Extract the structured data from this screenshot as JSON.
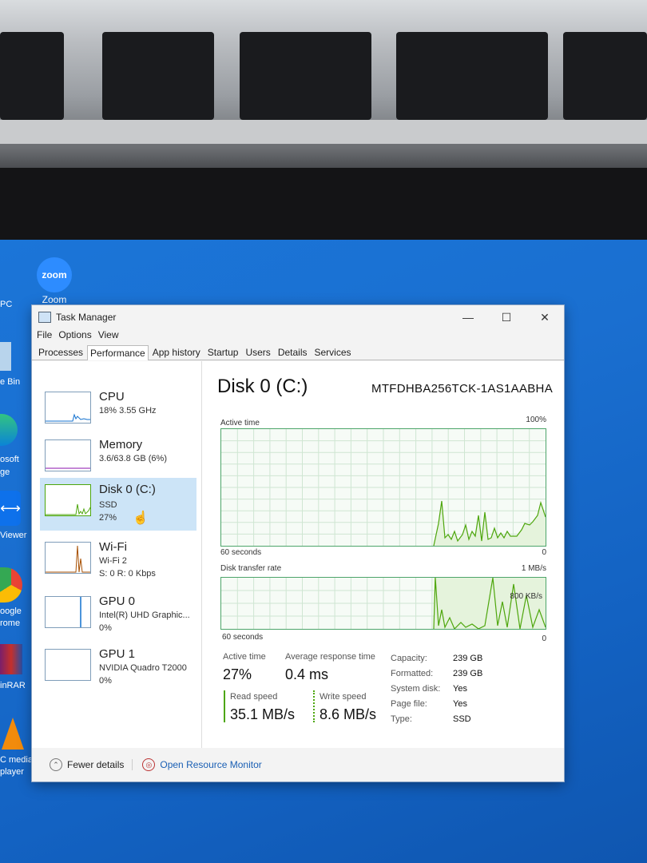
{
  "desktop": {
    "icons": [
      {
        "label": "Zoom",
        "icon": "zoom-icon",
        "badge": "zoom"
      },
      {
        "label": "PC"
      },
      {
        "label": "e Bin"
      },
      {
        "label": "osoft"
      },
      {
        "label": "ge"
      },
      {
        "label": "Viewer"
      },
      {
        "label": "oogle"
      },
      {
        "label": "rome"
      },
      {
        "label": "inRAR"
      },
      {
        "label": "C media"
      },
      {
        "label": "player"
      }
    ]
  },
  "window": {
    "title": "Task Manager",
    "menu": [
      "File",
      "Options",
      "View"
    ],
    "tabs": [
      "Processes",
      "Performance",
      "App history",
      "Startup",
      "Users",
      "Details",
      "Services"
    ],
    "active_tab": "Performance"
  },
  "sidebar": [
    {
      "name": "CPU",
      "line1": "18% 3.55 GHz",
      "line2": "",
      "color": "#1170cf"
    },
    {
      "name": "Memory",
      "line1": "3.6/63.8 GB (6%)",
      "line2": "",
      "color": "#8b12ae"
    },
    {
      "name": "Disk 0 (C:)",
      "line1": "SSD",
      "line2": "27%",
      "color": "#4da60c",
      "selected": true
    },
    {
      "name": "Wi-Fi",
      "line1": "Wi-Fi 2",
      "line2": "S: 0 R: 0 Kbps",
      "color": "#a74f01"
    },
    {
      "name": "GPU 0",
      "line1": "Intel(R) UHD Graphic...",
      "line2": "0%",
      "color": "#1170cf"
    },
    {
      "name": "GPU 1",
      "line1": "NVIDIA Quadro T2000",
      "line2": "0%",
      "color": "#1170cf"
    }
  ],
  "detail": {
    "title": "Disk 0 (C:)",
    "model": "MTFDHBA256TCK-1AS1AABHA",
    "graph1": {
      "label": "Active time",
      "max": "100%",
      "time": "60 seconds",
      "min": "0"
    },
    "graph2": {
      "label": "Disk transfer rate",
      "max": "1 MB/s",
      "inner": "800 KB/s",
      "time": "60 seconds",
      "min": "0"
    },
    "stats": {
      "active_time_label": "Active time",
      "active_time": "27%",
      "resp_label": "Average response time",
      "resp": "0.4 ms",
      "read_label": "Read speed",
      "read": "35.1 MB/s",
      "write_label": "Write speed",
      "write": "8.6 MB/s"
    },
    "props": [
      {
        "k": "Capacity:",
        "v": "239 GB"
      },
      {
        "k": "Formatted:",
        "v": "239 GB"
      },
      {
        "k": "System disk:",
        "v": "Yes"
      },
      {
        "k": "Page file:",
        "v": "Yes"
      },
      {
        "k": "Type:",
        "v": "SSD"
      }
    ]
  },
  "footer": {
    "fewer": "Fewer details",
    "monitor": "Open Resource Monitor"
  },
  "colors": {
    "disk_green": "#4da60c",
    "selection": "#cce4f7",
    "desktop_blue": "#1a6fd0"
  }
}
